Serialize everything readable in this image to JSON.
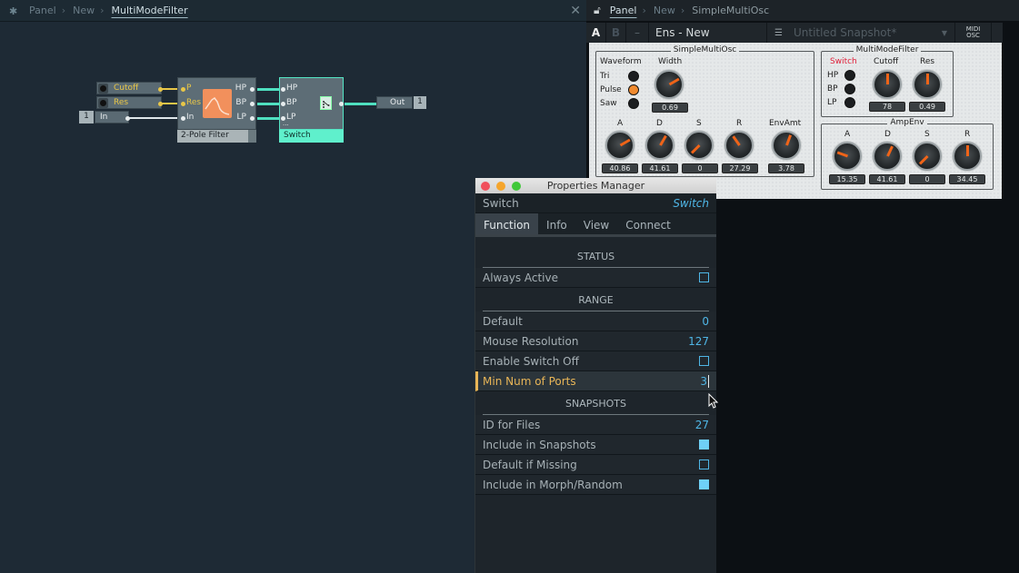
{
  "structure": {
    "breadcrumb": [
      "Panel",
      "New",
      "MultiModeFilter"
    ],
    "close_label": "✕",
    "nodes": {
      "cutoff": "Cutoff",
      "res": "Res",
      "in_num": "1",
      "in_label": "In",
      "filter": {
        "name": "2-Pole Filter",
        "inputs": [
          "P",
          "Res",
          "In"
        ],
        "outputs": [
          "HP",
          "BP",
          "LP"
        ]
      },
      "switch": {
        "name": "Switch",
        "inputs": [
          "HP",
          "BP",
          "LP"
        ],
        "dots": "..."
      },
      "out_label": "Out",
      "out_num": "1"
    }
  },
  "panel_view": {
    "breadcrumb": [
      "Panel",
      "New",
      "SimpleMultiOsc"
    ],
    "toolbar": {
      "a": "A",
      "b": "B",
      "minus": "–",
      "ensemble": "Ens - New",
      "snapshot": "Untitled Snapshot*",
      "midi": "MIDI",
      "osc": "OSC"
    },
    "simple_multi_osc": {
      "title": "SimpleMultiOsc",
      "waveform_label": "Waveform",
      "waveforms": [
        {
          "label": "Tri",
          "on": false
        },
        {
          "label": "Pulse",
          "on": true
        },
        {
          "label": "Saw",
          "on": false
        }
      ],
      "width": {
        "label": "Width",
        "value": "0.69"
      },
      "env": [
        {
          "label": "A",
          "value": "40.86"
        },
        {
          "label": "D",
          "value": "41.61"
        },
        {
          "label": "S",
          "value": "0"
        },
        {
          "label": "R",
          "value": "27.29"
        },
        {
          "label": "EnvAmt",
          "value": "3.78"
        }
      ]
    },
    "multi_mode_filter": {
      "title": "MultiModeFilter",
      "switch_label": "Switch",
      "switch_color": "#e0223c",
      "modes": [
        "HP",
        "BP",
        "LP"
      ],
      "cutoff": {
        "label": "Cutoff",
        "value": "78"
      },
      "res": {
        "label": "Res",
        "value": "0.49"
      }
    },
    "amp_env": {
      "title": "AmpEnv",
      "knobs": [
        {
          "label": "A",
          "value": "15.35"
        },
        {
          "label": "D",
          "value": "41.61"
        },
        {
          "label": "S",
          "value": "0"
        },
        {
          "label": "R",
          "value": "34.45"
        }
      ]
    }
  },
  "properties": {
    "window_title": "Properties Manager",
    "module_label": "Switch",
    "module_name": "Switch",
    "tabs": [
      "Function",
      "Info",
      "View",
      "Connect"
    ],
    "active_tab": "Function",
    "sections": {
      "status": {
        "title": "STATUS",
        "rows": [
          {
            "label": "Always Active",
            "type": "checkbox",
            "checked": false
          }
        ]
      },
      "range": {
        "title": "RANGE",
        "rows": [
          {
            "label": "Default",
            "value": "0"
          },
          {
            "label": "Mouse Resolution",
            "value": "127"
          },
          {
            "label": "Enable Switch Off",
            "type": "checkbox",
            "checked": false
          },
          {
            "label": "Min Num of Ports",
            "value": "3"
          }
        ]
      },
      "snapshots": {
        "title": "SNAPSHOTS",
        "rows": [
          {
            "label": "ID for Files",
            "value": "27"
          },
          {
            "label": "Include in Snapshots",
            "type": "checkbox",
            "checked": true
          },
          {
            "label": "Default if Missing",
            "type": "checkbox",
            "checked": false
          },
          {
            "label": "Include in Morph/Random",
            "type": "checkbox",
            "checked": true
          }
        ]
      }
    },
    "accent": "#4fb6e6",
    "selected_color": "#e8b557"
  }
}
